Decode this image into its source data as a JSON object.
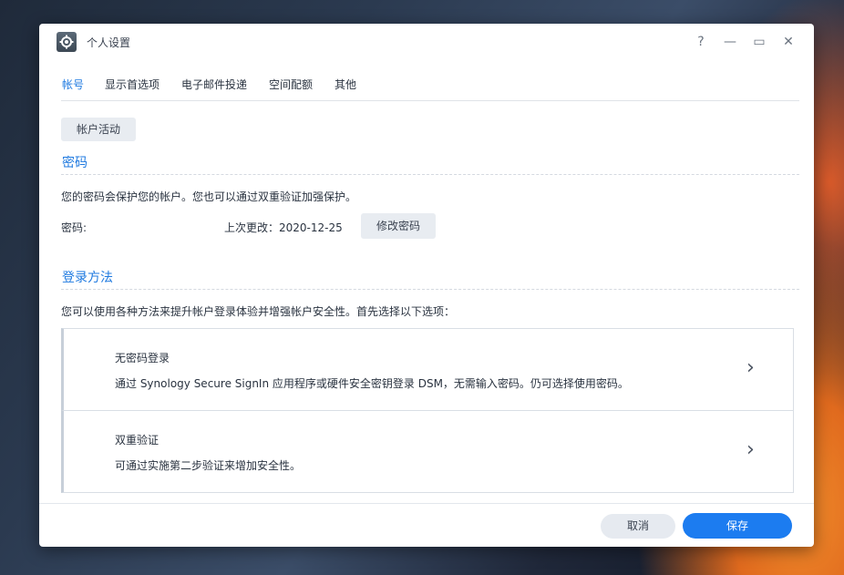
{
  "window": {
    "title": "个人设置",
    "help_label": "?",
    "minimize_label": "—",
    "maximize_label": "▭",
    "close_label": "✕"
  },
  "tabs": [
    {
      "label": "帐号",
      "active": true
    },
    {
      "label": "显示首选项",
      "active": false
    },
    {
      "label": "电子邮件投递",
      "active": false
    },
    {
      "label": "空间配额",
      "active": false
    },
    {
      "label": "其他",
      "active": false
    }
  ],
  "account": {
    "activity_button": "帐户活动"
  },
  "password": {
    "section_title": "密码",
    "description": "您的密码会保护您的帐户。您也可以通过双重验证加强保护。",
    "label": "密码:",
    "last_changed": "上次更改：2020-12-25",
    "change_button": "修改密码"
  },
  "login_methods": {
    "section_title": "登录方法",
    "description": "您可以使用各种方法来提升帐户登录体验并增强帐户安全性。首先选择以下选项：",
    "options": [
      {
        "title": "无密码登录",
        "description": "通过 Synology Secure SignIn 应用程序或硬件安全密钥登录 DSM，无需输入密码。仍可选择使用密码。",
        "chevron": "›"
      },
      {
        "title": "双重验证",
        "description": "可通过实施第二步验证来增加安全性。",
        "chevron": "›"
      }
    ]
  },
  "footer": {
    "cancel_label": "取消",
    "save_label": "保存"
  },
  "colors": {
    "accent": "#1f7ae0",
    "save_button": "#1c7cf0"
  }
}
